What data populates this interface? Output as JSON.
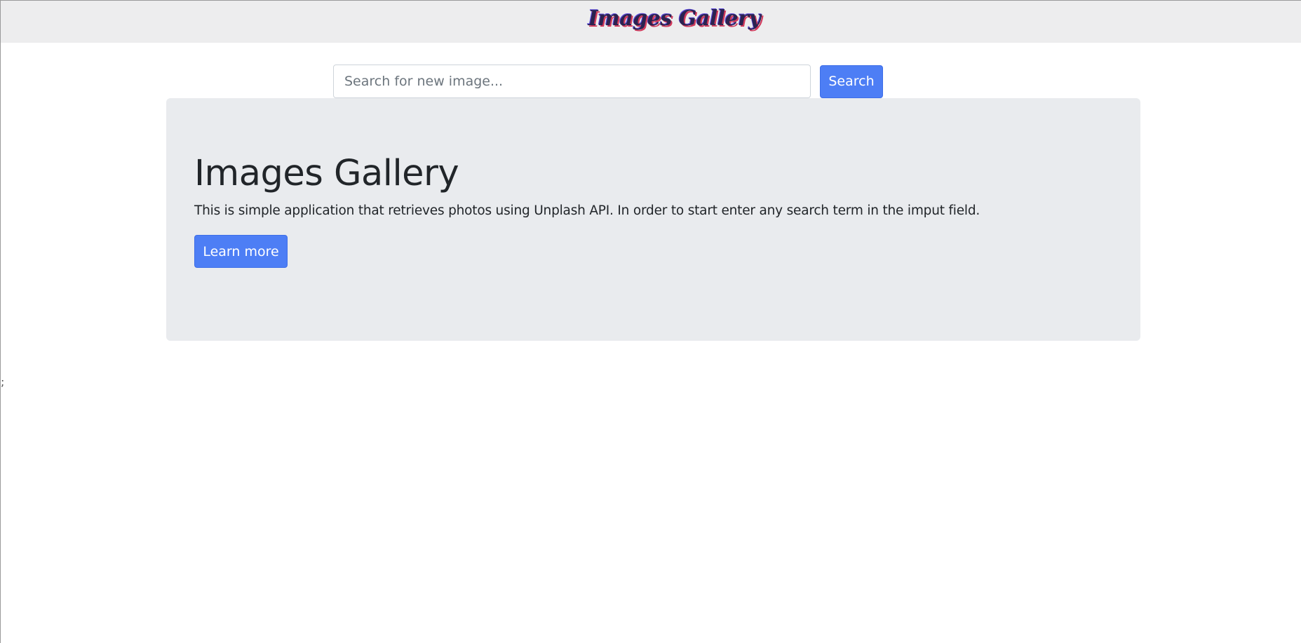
{
  "navbar": {
    "brand": "Images Gallery"
  },
  "search": {
    "placeholder": "Search for new image...",
    "value": "",
    "button_label": "Search"
  },
  "welcome": {
    "title": "Images Gallery",
    "lead": "This is simple application that retrieves photos using Unplash API. In order to start enter any search term in the imput field.",
    "button_label": "Learn more"
  },
  "stray_text": ";",
  "colors": {
    "navbar_bg": "#ededee",
    "primary": "#4d7ef5",
    "jumbotron_bg": "#e9ebee",
    "brand_text": "#2b2350"
  }
}
